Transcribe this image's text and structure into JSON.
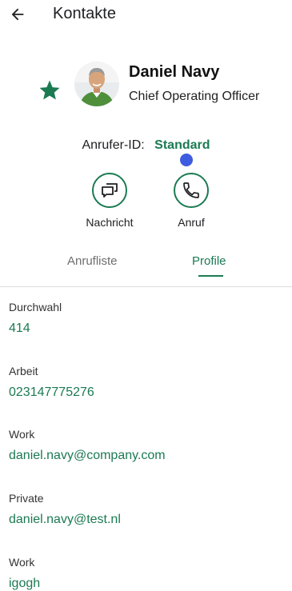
{
  "header": {
    "title": "Kontakte"
  },
  "contact": {
    "name": "Daniel Navy",
    "job_title": "Chief Operating Officer"
  },
  "caller_id": {
    "label": "Anrufer-ID:",
    "value": "Standard"
  },
  "actions": {
    "message_label": "Nachricht",
    "call_label": "Anruf"
  },
  "tabs": [
    {
      "label": "Anrufliste",
      "active": false
    },
    {
      "label": "Profile",
      "active": true
    }
  ],
  "fields": [
    {
      "label": "Durchwahl",
      "value": "414"
    },
    {
      "label": "Arbeit",
      "value": "023147775276"
    },
    {
      "label": "Work",
      "value": "daniel.navy@company.com"
    },
    {
      "label": "Private",
      "value": "daniel.navy@test.nl"
    },
    {
      "label": "Work",
      "value": "igogh"
    }
  ],
  "colors": {
    "accent": "#1b7a52",
    "presence": "#3d5ce0"
  }
}
